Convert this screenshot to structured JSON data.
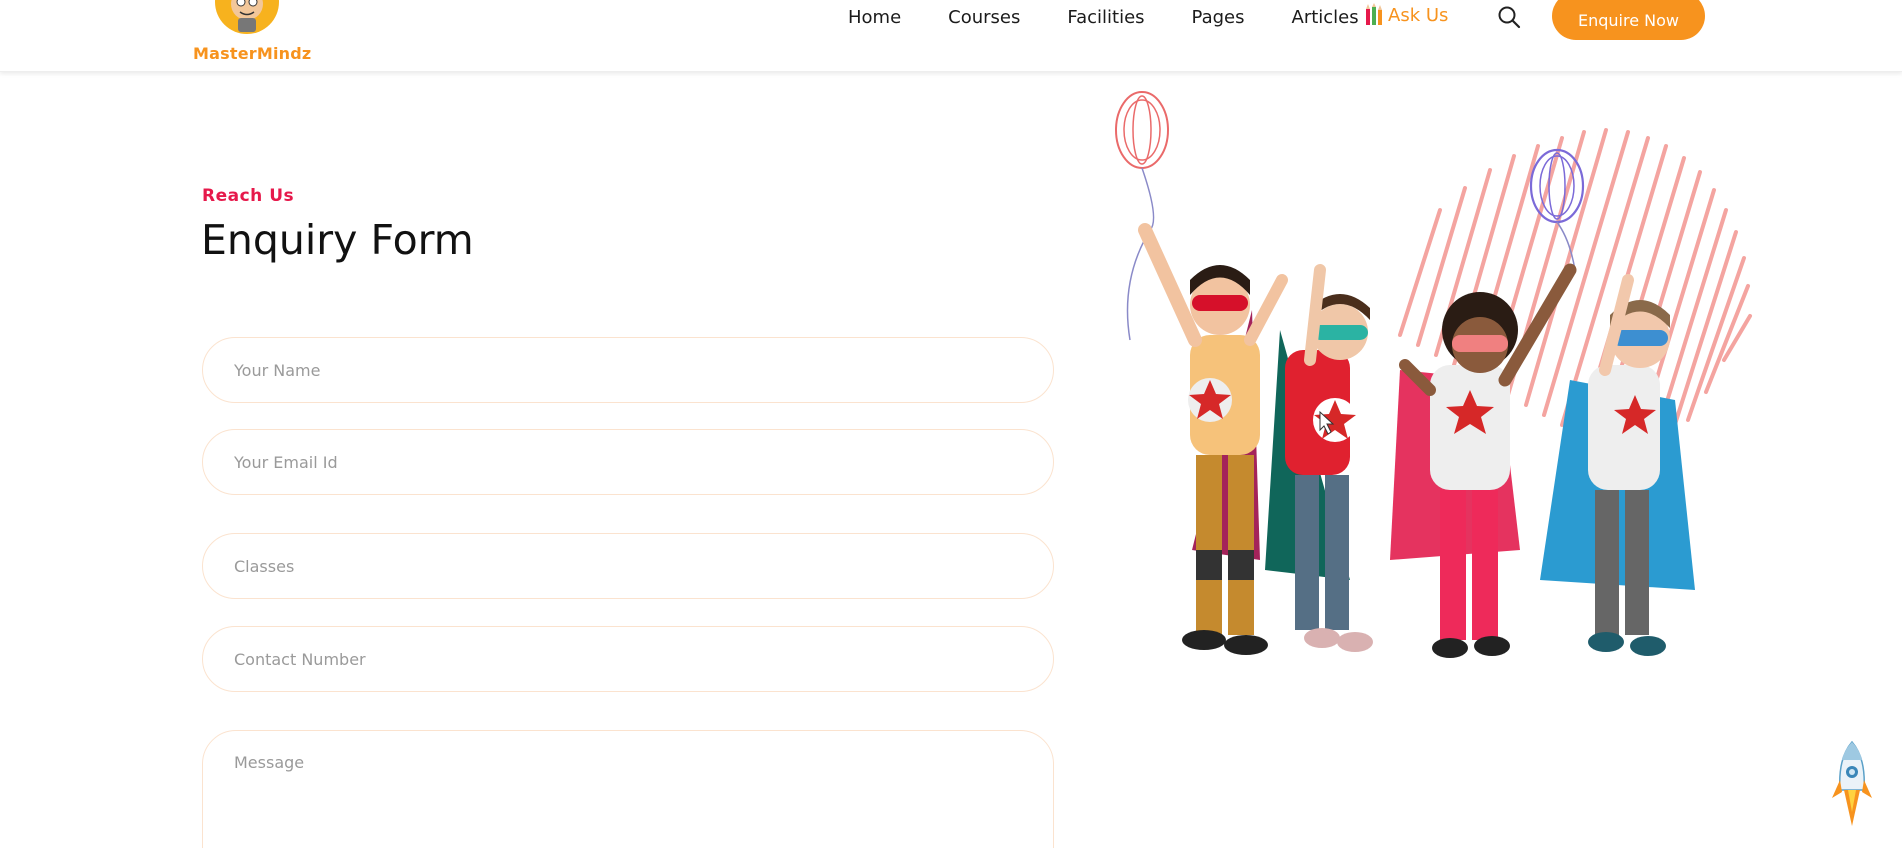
{
  "header": {
    "brand": "MasterMindz",
    "nav": [
      "Home",
      "Courses",
      "Facilities",
      "Pages",
      "Articles"
    ],
    "ask_us": "Ask Us",
    "enquire_label": "Enquire Now"
  },
  "form": {
    "eyebrow": "Reach Us",
    "title": "Enquiry Form",
    "name_placeholder": "Your Name",
    "email_placeholder": "Your Email Id",
    "classes_placeholder": "Classes",
    "contact_placeholder": "Contact Number",
    "message_placeholder": "Message"
  },
  "colors": {
    "accent": "#f7931e",
    "eyebrow": "#e6194b",
    "field_border": "#fbe3cf"
  },
  "icons": [
    "search-icon",
    "pencils-icon",
    "rocket-icon"
  ]
}
